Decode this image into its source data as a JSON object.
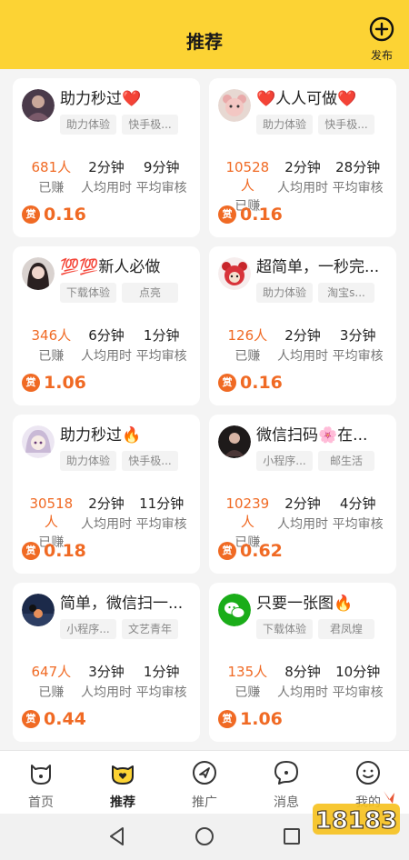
{
  "header": {
    "title": "推荐",
    "publish_label": "发布",
    "publish_icon": "plus-circle-icon"
  },
  "colors": {
    "brand_yellow": "#fcd334",
    "accent_orange": "#f06a24"
  },
  "cards": [
    {
      "title": "助力秒过❤️",
      "tags": [
        "助力体验",
        "快手极..."
      ],
      "earned": "681人",
      "earned_label": "已赚",
      "avg_time": "2分钟",
      "avg_time_label": "人均用时",
      "review": "9分钟",
      "review_label": "平均审核",
      "reward": "0.16",
      "reward_icon": "赏",
      "avatar": "photo-avatar"
    },
    {
      "title": "❤️人人可做❤️",
      "tags": [
        "助力体验",
        "快手极..."
      ],
      "earned": "10528人",
      "earned_label": "已赚",
      "avg_time": "2分钟",
      "avg_time_label": "人均用时",
      "review": "28分钟",
      "review_label": "平均审核",
      "reward": "0.16",
      "reward_icon": "赏",
      "avatar": "cartoon-bear-avatar"
    },
    {
      "title": "💯💯新人必做",
      "tags": [
        "下载体验",
        "点亮"
      ],
      "earned": "346人",
      "earned_label": "已赚",
      "avg_time": "6分钟",
      "avg_time_label": "人均用时",
      "review": "1分钟",
      "review_label": "平均审核",
      "reward": "1.06",
      "reward_icon": "赏",
      "avatar": "photo-avatar"
    },
    {
      "title": "超简单，一秒完...",
      "tags": [
        "助力体验",
        "淘宝s..."
      ],
      "earned": "126人",
      "earned_label": "已赚",
      "avg_time": "2分钟",
      "avg_time_label": "人均用时",
      "review": "3分钟",
      "review_label": "平均审核",
      "reward": "0.16",
      "reward_icon": "赏",
      "avatar": "red-bear-avatar"
    },
    {
      "title": "助力秒过🔥",
      "tags": [
        "助力体验",
        "快手极..."
      ],
      "earned": "30518人",
      "earned_label": "已赚",
      "avg_time": "2分钟",
      "avg_time_label": "人均用时",
      "review": "11分钟",
      "review_label": "平均审核",
      "reward": "0.18",
      "reward_icon": "赏",
      "avatar": "anime-avatar"
    },
    {
      "title": "微信扫码🌸在...",
      "tags": [
        "小程序...",
        "邮生活"
      ],
      "earned": "10239人",
      "earned_label": "已赚",
      "avg_time": "2分钟",
      "avg_time_label": "人均用时",
      "review": "4分钟",
      "review_label": "平均审核",
      "reward": "0.62",
      "reward_icon": "赏",
      "avatar": "photo-avatar"
    },
    {
      "title": "简单，微信扫一...",
      "tags": [
        "小程序...",
        "文艺青年"
      ],
      "earned": "647人",
      "earned_label": "已赚",
      "avg_time": "3分钟",
      "avg_time_label": "人均用时",
      "review": "1分钟",
      "review_label": "平均审核",
      "reward": "0.44",
      "reward_icon": "赏",
      "avatar": "sunset-avatar"
    },
    {
      "title": "只要一张图🔥",
      "tags": [
        "下载体验",
        "君凤煌"
      ],
      "earned": "135人",
      "earned_label": "已赚",
      "avg_time": "8分钟",
      "avg_time_label": "人均用时",
      "review": "10分钟",
      "review_label": "平均审核",
      "reward": "1.06",
      "reward_icon": "赏",
      "avatar": "wechat-logo-avatar"
    }
  ],
  "tabbar": [
    {
      "label": "首页",
      "icon": "cat-face-icon",
      "active": false
    },
    {
      "label": "推荐",
      "icon": "heart-face-icon",
      "active": true
    },
    {
      "label": "推广",
      "icon": "send-arrow-icon",
      "active": false
    },
    {
      "label": "消息",
      "icon": "chat-bubble-icon",
      "active": false
    },
    {
      "label": "我的",
      "icon": "smile-face-icon",
      "active": false
    }
  ],
  "system_nav": [
    "back-icon",
    "home-icon",
    "recents-icon"
  ]
}
